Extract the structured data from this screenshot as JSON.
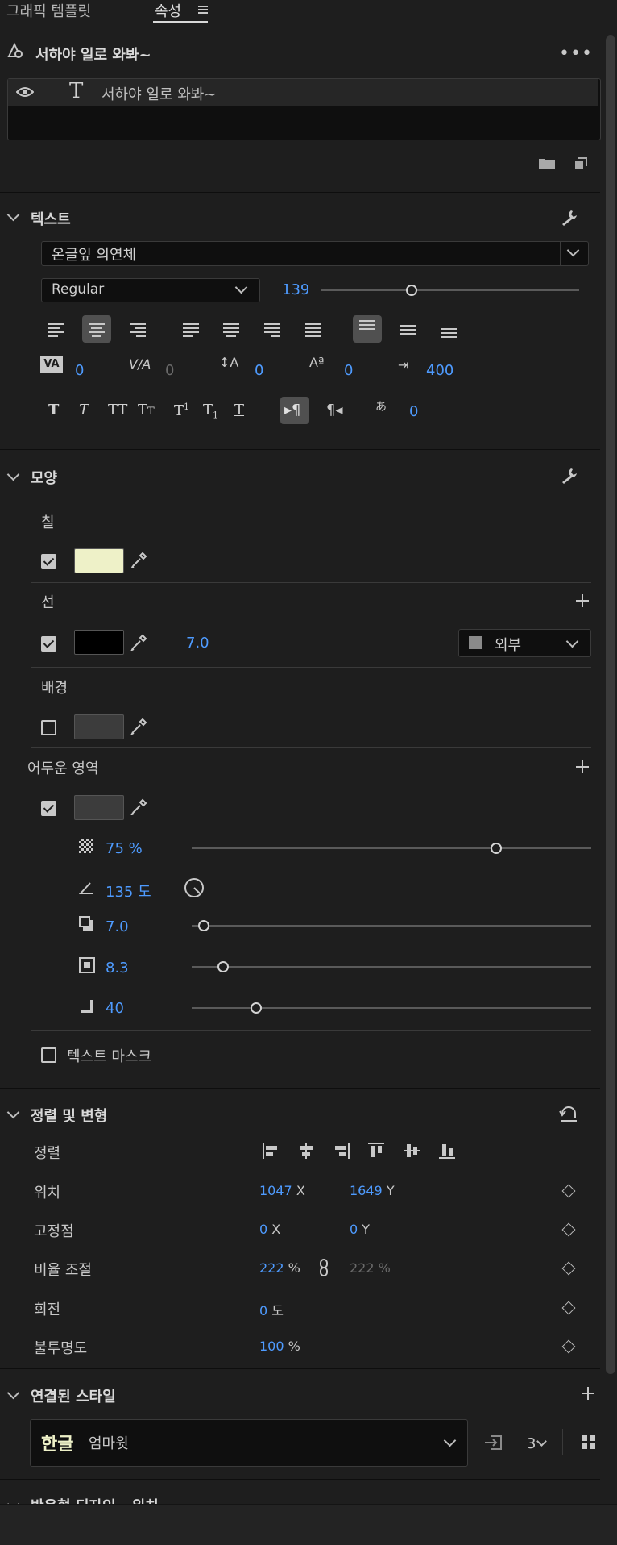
{
  "tabs": {
    "graphic_templates": "그래픽 템플릿",
    "properties": "속성"
  },
  "layer": {
    "title": "서하야 일로 와봐~",
    "item_name": "서하야 일로 와봐~"
  },
  "text_section": {
    "title": "텍스트",
    "font_family": "온글잎 의연체",
    "font_style": "Regular",
    "font_size": "139",
    "font_size_slider": 0.35,
    "kerning": "0",
    "tracking": "0",
    "leading": "0",
    "baseline_shift": "0",
    "tab_width": "400",
    "tsume": "0"
  },
  "appearance": {
    "title": "모양",
    "fill": {
      "label": "칠",
      "enabled": true,
      "color": "#eef1c8"
    },
    "stroke": {
      "label": "선",
      "enabled": true,
      "color": "#000000",
      "width": "7.0",
      "position": "외부"
    },
    "background": {
      "label": "배경",
      "enabled": false
    },
    "shadow": {
      "label": "어두운 영역",
      "enabled": true,
      "opacity": "75 %",
      "opacity_slider": 0.75,
      "angle": "135 도",
      "distance": "7.0",
      "distance_slider": 0.03,
      "size": "8.3",
      "size_slider": 0.08,
      "blur": "40",
      "blur_slider": 0.16
    },
    "text_mask": {
      "label": "텍스트 마스크",
      "enabled": false
    }
  },
  "align_transform": {
    "title": "정렬 및 변형",
    "align_label": "정렬",
    "position_label": "위치",
    "position_x": "1047",
    "position_y": "1649",
    "anchor_label": "고정점",
    "anchor_x": "0",
    "anchor_y": "0",
    "scale_label": "비율 조절",
    "scale_value": "222",
    "scale_value2": "222 %",
    "rotation_label": "회전",
    "rotation_value": "0",
    "rotation_unit": "도",
    "opacity_label": "불투명도",
    "opacity_value": "100",
    "x_unit": "X",
    "y_unit": "Y",
    "pct_unit": "%"
  },
  "linked_styles": {
    "title": "연결된 스타일",
    "style_badge": "한글",
    "style_name": "엄마윗",
    "count": "3"
  },
  "next_section": {
    "title": "반응형 디자인 - 위치"
  }
}
